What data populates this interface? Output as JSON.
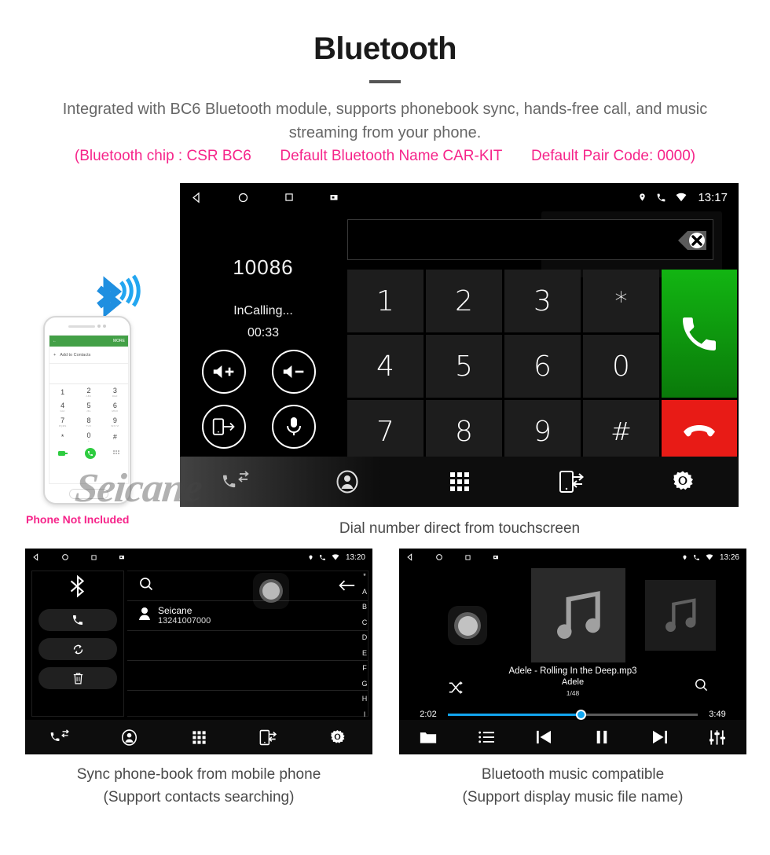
{
  "header": {
    "title": "Bluetooth",
    "subtitle": "Integrated with BC6 Bluetooth module, supports phonebook sync, hands-free call, and music streaming from your phone.",
    "spec_chip": "(Bluetooth chip : CSR BC6",
    "spec_name": "Default Bluetooth Name CAR-KIT",
    "spec_pair": "Default Pair Code: 0000)",
    "accent_pink": "#f6248a",
    "body_gray": "#666666"
  },
  "phone_mock": {
    "note": "Phone Not Included",
    "app_bar_more": "MORE",
    "add_contacts": "Add to Contacts",
    "keys": [
      {
        "digit": "1",
        "sub": ""
      },
      {
        "digit": "2",
        "sub": "ABC"
      },
      {
        "digit": "3",
        "sub": "DEF"
      },
      {
        "digit": "4",
        "sub": "GHI"
      },
      {
        "digit": "5",
        "sub": "JKL"
      },
      {
        "digit": "6",
        "sub": "MNO"
      },
      {
        "digit": "7",
        "sub": "PQRS"
      },
      {
        "digit": "8",
        "sub": "TUV"
      },
      {
        "digit": "9",
        "sub": "WXYZ"
      },
      {
        "digit": "*",
        "sub": ""
      },
      {
        "digit": "0",
        "sub": "+"
      },
      {
        "digit": "#",
        "sub": ""
      }
    ]
  },
  "watermark": {
    "text": "Seicane"
  },
  "dialer": {
    "caption": "Dial number direct from touchscreen",
    "status_bar": {
      "time": "13:17",
      "nav_icons": [
        "back-icon",
        "home-icon",
        "recents-icon",
        "screenshot-icon"
      ],
      "status_icons": [
        "location-icon",
        "call-icon",
        "wifi-icon"
      ]
    },
    "number": "10086",
    "call_state": "InCalling...",
    "call_timer": "00:33",
    "input_value": "",
    "controls": [
      "volume-up-icon",
      "volume-down-icon",
      "transfer-to-phone-icon",
      "mute-mic-icon"
    ],
    "keys": [
      "1",
      "2",
      "3",
      "*",
      "4",
      "5",
      "6",
      "0",
      "7",
      "8",
      "9",
      "#"
    ],
    "call_button": "answer-call",
    "end_button": "end-call",
    "nav_items": [
      "call-log-icon",
      "contacts-icon",
      "keypad-icon",
      "phone-transfer-icon",
      "settings-icon"
    ],
    "colors": {
      "answer": "#12b512",
      "end": "#e81b16",
      "key_bg": "#1d1d1d"
    }
  },
  "phonebook": {
    "caption_line1": "Sync phone-book from mobile phone",
    "caption_line2": "(Support contacts searching)",
    "status_bar": {
      "time": "13:20"
    },
    "sidebar_icons": [
      "bluetooth-icon",
      "call-icon",
      "sync-icon",
      "delete-icon"
    ],
    "search_placeholder": "",
    "contacts": [
      {
        "name": "Seicane",
        "number": "13241007000"
      }
    ],
    "index_letters": [
      "*",
      "A",
      "B",
      "C",
      "D",
      "E",
      "F",
      "G",
      "H",
      "I"
    ],
    "nav_items": [
      "call-log-icon",
      "contacts-icon",
      "keypad-icon",
      "phone-transfer-icon",
      "settings-icon"
    ]
  },
  "music": {
    "caption_line1": "Bluetooth music compatible",
    "caption_line2": "(Support display music file name)",
    "status_bar": {
      "time": "13:26"
    },
    "track": "Adele - Rolling In the Deep.mp3",
    "artist": "Adele",
    "track_count": "1/48",
    "elapsed": "2:02",
    "duration": "3:49",
    "progress_percent": 53,
    "accent": "#12a5ef",
    "nav_items": [
      "folder-icon",
      "playlist-icon",
      "previous-icon",
      "pause-icon",
      "next-icon",
      "equalizer-icon"
    ]
  }
}
